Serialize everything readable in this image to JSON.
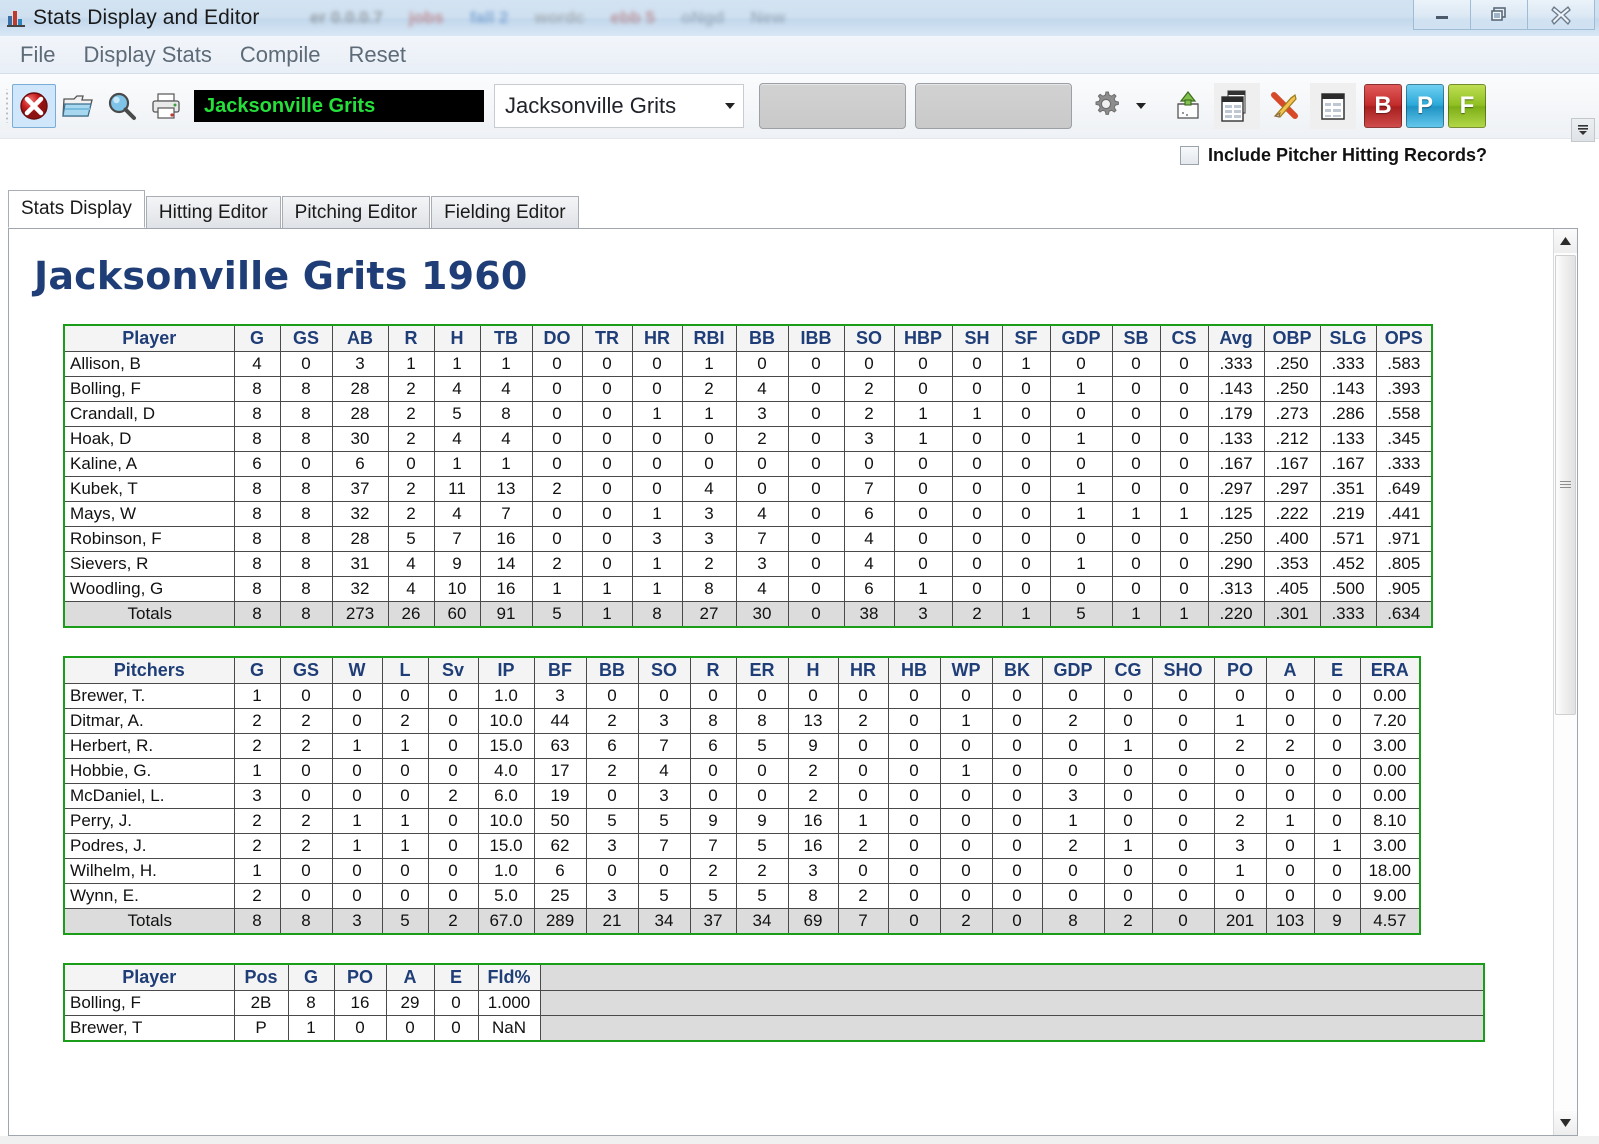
{
  "window": {
    "title": "Stats Display and Editor",
    "icon": "chart-icon",
    "ghost_tabs": [
      "er 0.0.0.7",
      "jobs",
      "fall 2",
      "wordc",
      "ebb 5",
      "oNgd",
      "New"
    ],
    "controls": {
      "minimize": "minimize-button",
      "maximize": "maximize-button",
      "close": "close-button"
    }
  },
  "menu": {
    "items": [
      "File",
      "Display Stats",
      "Compile",
      "Reset"
    ]
  },
  "toolbar": {
    "buttons": [
      {
        "name": "close-tool-icon",
        "label": ""
      },
      {
        "name": "open-folder-icon",
        "label": ""
      },
      {
        "name": "magnifier-icon",
        "label": ""
      },
      {
        "name": "printer-icon",
        "label": ""
      }
    ],
    "marquee_text": "Jacksonville Grits",
    "team_combo_value": "Jacksonville Grits",
    "field1_value": "",
    "field2_value": "",
    "gear_label": "",
    "right_buttons": [
      {
        "name": "export-icon"
      },
      {
        "name": "copy-table-icon"
      },
      {
        "name": "delete-x-icon"
      },
      {
        "name": "list-view-icon"
      }
    ],
    "bpf": [
      {
        "letter": "B",
        "name": "batting-button"
      },
      {
        "letter": "P",
        "name": "pitching-button"
      },
      {
        "letter": "F",
        "name": "fielding-button"
      }
    ],
    "checkbox_label": "Include Pitcher Hitting Records?",
    "checkbox_checked": false
  },
  "tabs": {
    "items": [
      "Stats Display",
      "Hitting Editor",
      "Pitching Editor",
      "Fielding Editor"
    ],
    "active": "Stats Display"
  },
  "page": {
    "heading": "Jacksonville Grits 1960"
  },
  "chart_data": [
    {
      "type": "table",
      "title": "Hitting",
      "categories": [
        "Player",
        "G",
        "GS",
        "AB",
        "R",
        "H",
        "TB",
        "DO",
        "TR",
        "HR",
        "RBI",
        "BB",
        "IBB",
        "SO",
        "HBP",
        "SH",
        "SF",
        "GDP",
        "SB",
        "CS",
        "Avg",
        "OBP",
        "SLG",
        "OPS"
      ],
      "rows": [
        [
          "Allison, B",
          "4",
          "0",
          "3",
          "1",
          "1",
          "1",
          "0",
          "0",
          "0",
          "1",
          "0",
          "0",
          "0",
          "0",
          "0",
          "1",
          "0",
          "0",
          "0",
          ".333",
          ".250",
          ".333",
          ".583"
        ],
        [
          "Bolling, F",
          "8",
          "8",
          "28",
          "2",
          "4",
          "4",
          "0",
          "0",
          "0",
          "2",
          "4",
          "0",
          "2",
          "0",
          "0",
          "0",
          "1",
          "0",
          "0",
          ".143",
          ".250",
          ".143",
          ".393"
        ],
        [
          "Crandall, D",
          "8",
          "8",
          "28",
          "2",
          "5",
          "8",
          "0",
          "0",
          "1",
          "1",
          "3",
          "0",
          "2",
          "1",
          "1",
          "0",
          "0",
          "0",
          "0",
          ".179",
          ".273",
          ".286",
          ".558"
        ],
        [
          "Hoak, D",
          "8",
          "8",
          "30",
          "2",
          "4",
          "4",
          "0",
          "0",
          "0",
          "0",
          "2",
          "0",
          "3",
          "1",
          "0",
          "0",
          "1",
          "0",
          "0",
          ".133",
          ".212",
          ".133",
          ".345"
        ],
        [
          "Kaline, A",
          "6",
          "0",
          "6",
          "0",
          "1",
          "1",
          "0",
          "0",
          "0",
          "0",
          "0",
          "0",
          "0",
          "0",
          "0",
          "0",
          "0",
          "0",
          "0",
          ".167",
          ".167",
          ".167",
          ".333"
        ],
        [
          "Kubek, T",
          "8",
          "8",
          "37",
          "2",
          "11",
          "13",
          "2",
          "0",
          "0",
          "4",
          "0",
          "0",
          "7",
          "0",
          "0",
          "0",
          "1",
          "0",
          "0",
          ".297",
          ".297",
          ".351",
          ".649"
        ],
        [
          "Mays, W",
          "8",
          "8",
          "32",
          "2",
          "4",
          "7",
          "0",
          "0",
          "1",
          "3",
          "4",
          "0",
          "6",
          "0",
          "0",
          "0",
          "1",
          "1",
          "1",
          ".125",
          ".222",
          ".219",
          ".441"
        ],
        [
          "Robinson, F",
          "8",
          "8",
          "28",
          "5",
          "7",
          "16",
          "0",
          "0",
          "3",
          "3",
          "7",
          "0",
          "4",
          "0",
          "0",
          "0",
          "0",
          "0",
          "0",
          ".250",
          ".400",
          ".571",
          ".971"
        ],
        [
          "Sievers, R",
          "8",
          "8",
          "31",
          "4",
          "9",
          "14",
          "2",
          "0",
          "1",
          "2",
          "3",
          "0",
          "4",
          "0",
          "0",
          "0",
          "1",
          "0",
          "0",
          ".290",
          ".353",
          ".452",
          ".805"
        ],
        [
          "Woodling, G",
          "8",
          "8",
          "32",
          "4",
          "10",
          "16",
          "1",
          "1",
          "1",
          "8",
          "4",
          "0",
          "6",
          "1",
          "0",
          "0",
          "0",
          "0",
          "0",
          ".313",
          ".405",
          ".500",
          ".905"
        ]
      ],
      "totals": [
        "Totals",
        "8",
        "8",
        "273",
        "26",
        "60",
        "91",
        "5",
        "1",
        "8",
        "27",
        "30",
        "0",
        "38",
        "3",
        "2",
        "1",
        "5",
        "1",
        "1",
        ".220",
        ".301",
        ".333",
        ".634"
      ]
    },
    {
      "type": "table",
      "title": "Pitching",
      "categories": [
        "Pitchers",
        "G",
        "GS",
        "W",
        "L",
        "Sv",
        "IP",
        "BF",
        "BB",
        "SO",
        "R",
        "ER",
        "H",
        "HR",
        "HB",
        "WP",
        "BK",
        "GDP",
        "CG",
        "SHO",
        "PO",
        "A",
        "E",
        "ERA"
      ],
      "rows": [
        [
          "Brewer, T.",
          "1",
          "0",
          "0",
          "0",
          "0",
          "1.0",
          "3",
          "0",
          "0",
          "0",
          "0",
          "0",
          "0",
          "0",
          "0",
          "0",
          "0",
          "0",
          "0",
          "0",
          "0",
          "0",
          "0.00"
        ],
        [
          "Ditmar, A.",
          "2",
          "2",
          "0",
          "2",
          "0",
          "10.0",
          "44",
          "2",
          "3",
          "8",
          "8",
          "13",
          "2",
          "0",
          "1",
          "0",
          "2",
          "0",
          "0",
          "1",
          "0",
          "0",
          "7.20"
        ],
        [
          "Herbert, R.",
          "2",
          "2",
          "1",
          "1",
          "0",
          "15.0",
          "63",
          "6",
          "7",
          "6",
          "5",
          "9",
          "0",
          "0",
          "0",
          "0",
          "0",
          "1",
          "0",
          "2",
          "2",
          "0",
          "3.00"
        ],
        [
          "Hobbie, G.",
          "1",
          "0",
          "0",
          "0",
          "0",
          "4.0",
          "17",
          "2",
          "4",
          "0",
          "0",
          "2",
          "0",
          "0",
          "1",
          "0",
          "0",
          "0",
          "0",
          "0",
          "0",
          "0",
          "0.00"
        ],
        [
          "McDaniel, L.",
          "3",
          "0",
          "0",
          "0",
          "2",
          "6.0",
          "19",
          "0",
          "3",
          "0",
          "0",
          "2",
          "0",
          "0",
          "0",
          "0",
          "3",
          "0",
          "0",
          "0",
          "0",
          "0",
          "0.00"
        ],
        [
          "Perry, J.",
          "2",
          "2",
          "1",
          "1",
          "0",
          "10.0",
          "50",
          "5",
          "5",
          "9",
          "9",
          "16",
          "1",
          "0",
          "0",
          "0",
          "1",
          "0",
          "0",
          "2",
          "1",
          "0",
          "8.10"
        ],
        [
          "Podres, J.",
          "2",
          "2",
          "1",
          "1",
          "0",
          "15.0",
          "62",
          "3",
          "7",
          "7",
          "5",
          "16",
          "2",
          "0",
          "0",
          "0",
          "2",
          "1",
          "0",
          "3",
          "0",
          "1",
          "3.00"
        ],
        [
          "Wilhelm, H.",
          "1",
          "0",
          "0",
          "0",
          "0",
          "1.0",
          "6",
          "0",
          "0",
          "2",
          "2",
          "3",
          "0",
          "0",
          "0",
          "0",
          "0",
          "0",
          "0",
          "1",
          "0",
          "0",
          "18.00"
        ],
        [
          "Wynn, E.",
          "2",
          "0",
          "0",
          "0",
          "0",
          "5.0",
          "25",
          "3",
          "5",
          "5",
          "5",
          "8",
          "2",
          "0",
          "0",
          "0",
          "0",
          "0",
          "0",
          "0",
          "0",
          "0",
          "9.00"
        ]
      ],
      "totals": [
        "Totals",
        "8",
        "8",
        "3",
        "5",
        "2",
        "67.0",
        "289",
        "21",
        "34",
        "37",
        "34",
        "69",
        "7",
        "0",
        "2",
        "0",
        "8",
        "2",
        "0",
        "201",
        "103",
        "9",
        "4.57"
      ]
    },
    {
      "type": "table",
      "title": "Fielding",
      "categories": [
        "Player",
        "Pos",
        "G",
        "PO",
        "A",
        "E",
        "Fld%"
      ],
      "rows": [
        [
          "Bolling, F",
          "2B",
          "8",
          "16",
          "29",
          "0",
          "1.000"
        ],
        [
          "Brewer, T",
          "P",
          "1",
          "0",
          "0",
          "0",
          "NaN"
        ]
      ],
      "totals": []
    }
  ],
  "colors": {
    "table_border": "#1a9e1a",
    "header_text": "#1f3e77",
    "heading": "#1f3e77",
    "marquee_bg": "#000000",
    "marquee_text": "#25e03a",
    "totals_bg": "#dcdcdc"
  }
}
